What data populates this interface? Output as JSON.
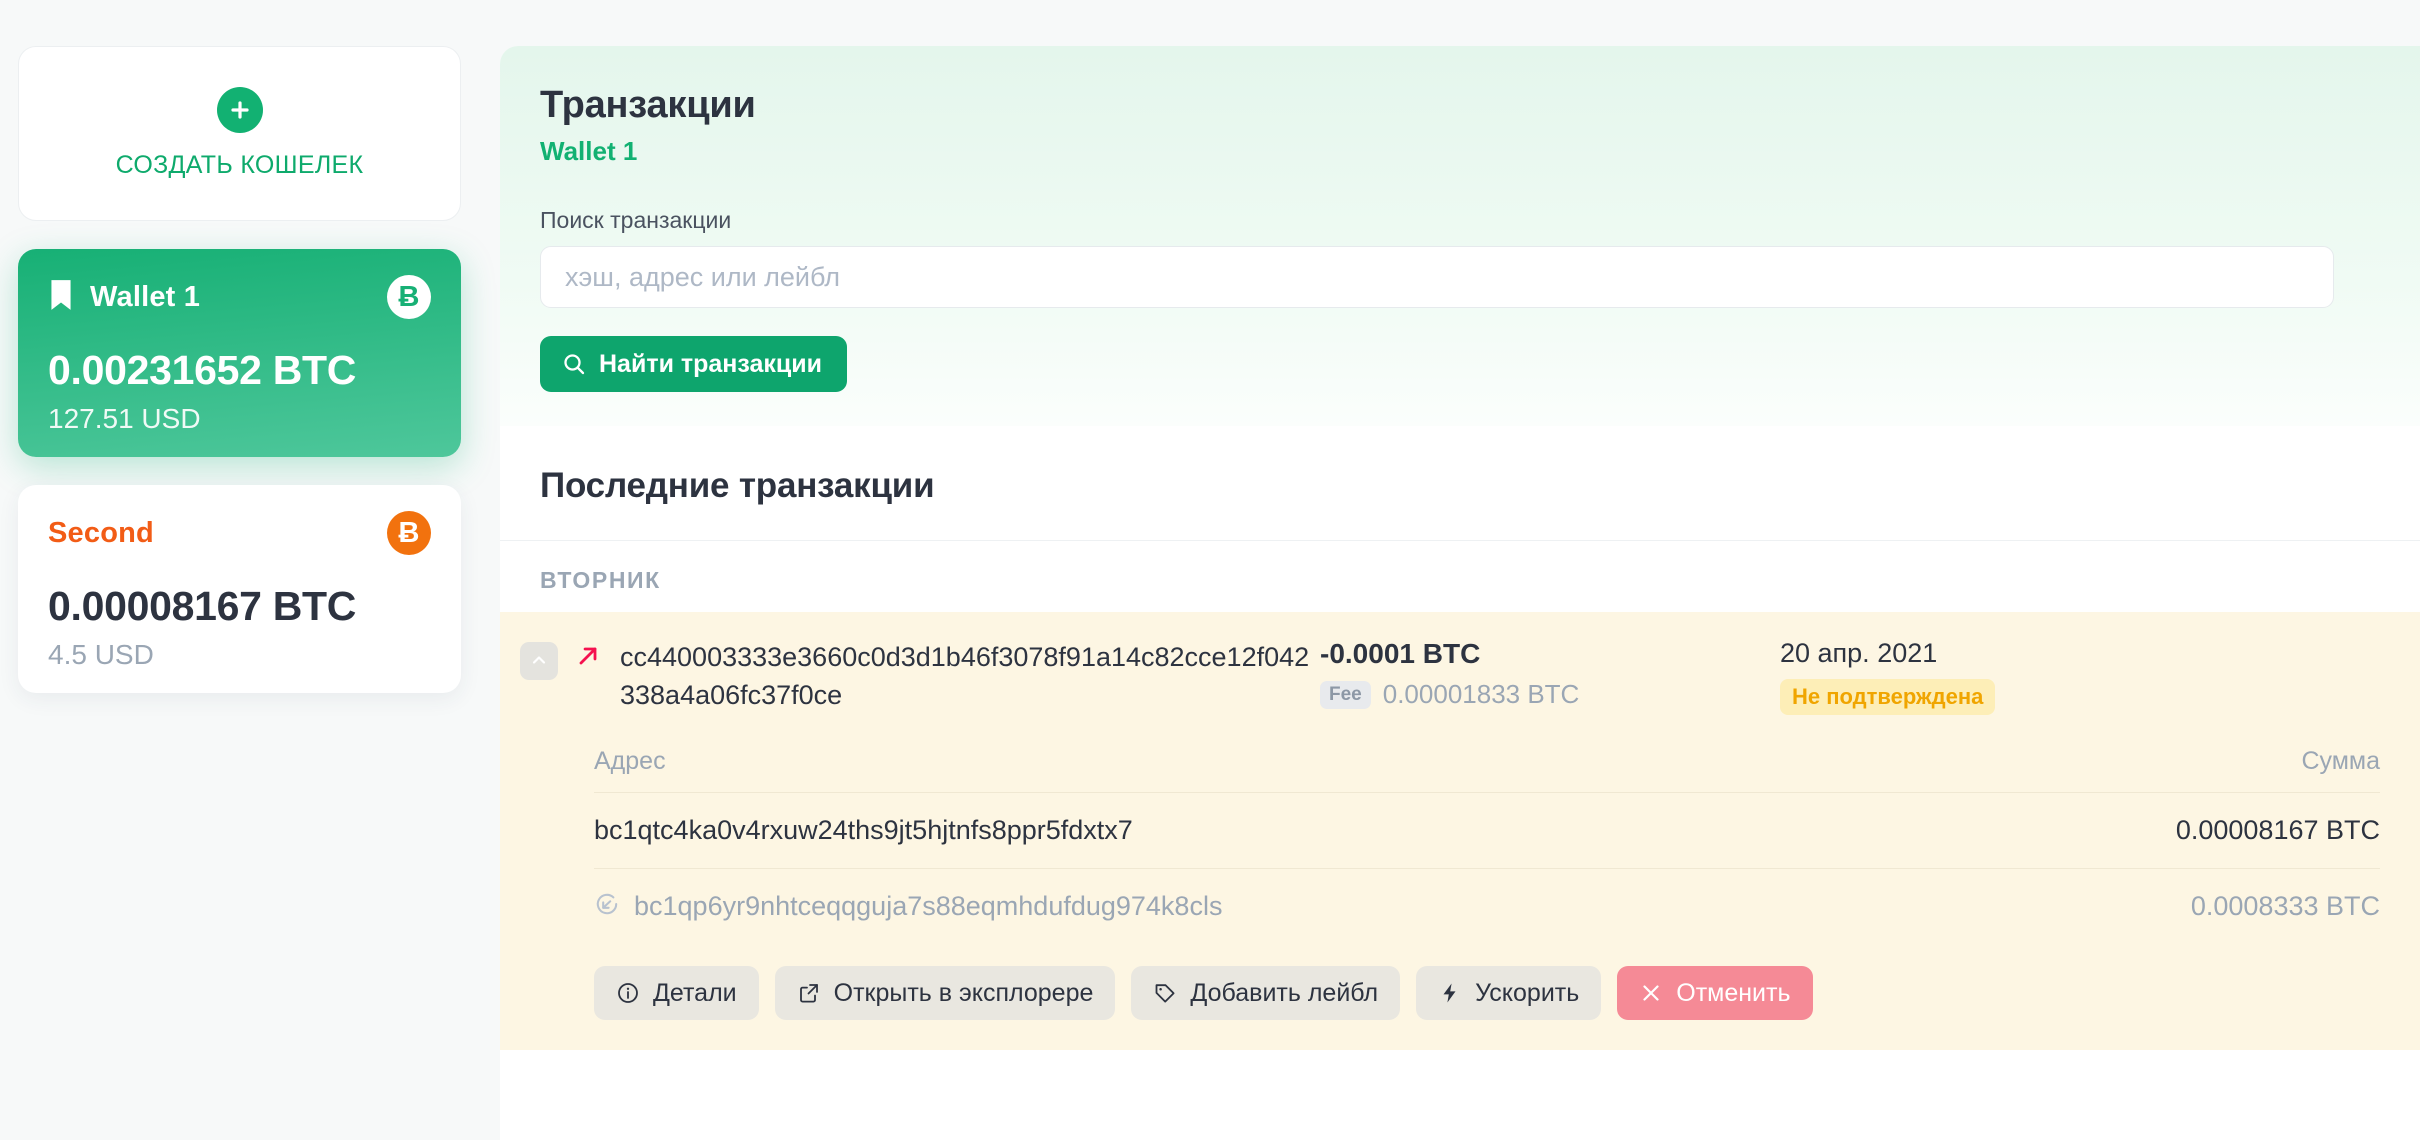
{
  "sidebar": {
    "create_wallet_label": "СОЗДАТЬ КОШЕЛЕК",
    "wallets": [
      {
        "name": "Wallet 1",
        "balance": "0.00231652 BTC",
        "fiat": "127.51 USD",
        "currency_symbol": "Ƀ",
        "active": true
      },
      {
        "name": "Second",
        "balance": "0.00008167 BTC",
        "fiat": "4.5 USD",
        "currency_symbol": "Ƀ",
        "active": false
      }
    ]
  },
  "header": {
    "title": "Транзакции",
    "wallet": "Wallet 1",
    "search_label": "Поиск транзакции",
    "search_placeholder": "хэш, адрес или лейбл",
    "search_value": "",
    "search_button": "Найти транзакции"
  },
  "recent": {
    "title": "Последние транзакции",
    "day_group": "ВТОРНИК"
  },
  "transaction": {
    "hash": "cc440003333e3660c0d3d1b46f3078f91a14c82cce12f042338a4a06fc37f0ce",
    "amount": "-0.0001 BTC",
    "fee_label": "Fee",
    "fee_value": "0.00001833 BTC",
    "date": "20 апр. 2021",
    "status": "Не подтверждена",
    "table": {
      "col_address": "Адрес",
      "col_amount": "Сумма",
      "rows": [
        {
          "address": "bc1qtc4ka0v4rxuw24ths9jt5hjtnfs8ppr5fdxtx7",
          "amount": "0.00008167 BTC",
          "muted": false,
          "has_icon": false
        },
        {
          "address": "bc1qp6yr9nhtceqqguja7s88eqmhdufdug974k8cls",
          "amount": "0.0008333 BTC",
          "muted": true,
          "has_icon": true
        }
      ]
    },
    "actions": [
      {
        "label": "Детали",
        "icon": "info-icon",
        "style": "default"
      },
      {
        "label": "Открыть в эксплорере",
        "icon": "external-link-icon",
        "style": "default"
      },
      {
        "label": "Добавить лейбл",
        "icon": "tag-icon",
        "style": "default"
      },
      {
        "label": "Ускорить",
        "icon": "bolt-icon",
        "style": "default"
      },
      {
        "label": "Отменить",
        "icon": "close-icon",
        "style": "danger"
      }
    ]
  },
  "colors": {
    "brand_green": "#12b172",
    "accent_orange": "#f25c16",
    "warning_yellow": "#f0a500",
    "danger_pink": "#f58a96",
    "tx_row_bg": "#fdf6e3",
    "outgoing_arrow": "#f5114f"
  }
}
